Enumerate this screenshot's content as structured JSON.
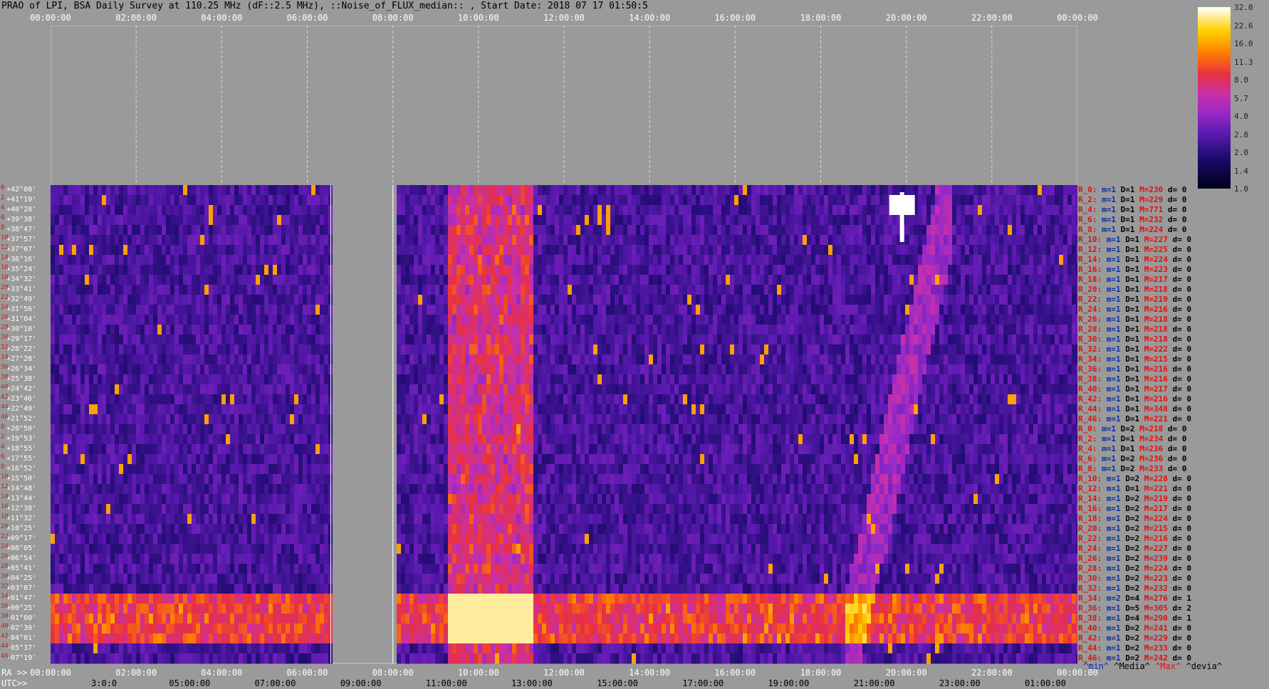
{
  "title": "PRAO of LPI, BSA Daily Survey at 110.25 MHz (dF::2.5 MHz), ::Noise_of_FLUX_median:: , Start Date: 2018 07 17 01:50:5",
  "top_ticks": [
    "00:00:00",
    "02:00:00",
    "04:00:00",
    "06:00:00",
    "08:00:00",
    "10:00:00",
    "12:00:00",
    "14:00:00",
    "16:00:00",
    "18:00:00",
    "20:00:00",
    "22:00:00",
    "00:00:00"
  ],
  "ra_label": "RA >>",
  "ra_ticks": [
    "00:00:00",
    "02:00:00",
    "04:00:00",
    "06:00:00",
    "08:00:00",
    "10:00:00",
    "12:00:00",
    "14:00:00",
    "16:00:00",
    "18:00:00",
    "20:00:00",
    "22:00:00",
    "00:00:00"
  ],
  "utc_label": "UTC>>",
  "utc_ticks": [
    "3:0:0",
    "05:00:00",
    "07:00:00",
    "09:00:00",
    "11:00:00",
    "13:00:00",
    "15:00:00",
    "17:00:00",
    "19:00:00",
    "21:00:00",
    "23:00:00",
    "01:00:00"
  ],
  "declinations": [
    "+42°08'",
    "+41°19'",
    "+40°28'",
    "+39°38'",
    "+38°47'",
    "+37°57'",
    "+37°07'",
    "+36°16'",
    "+35°24'",
    "+34°32'",
    "+33°41'",
    "+32°49'",
    "+31°56'",
    "+31°04'",
    "+30°10'",
    "+29°17'",
    "+28°22'",
    "+27°28'",
    "+26°34'",
    "+25°38'",
    "+24°42'",
    "+23°46'",
    "+22°49'",
    "+21°52'",
    "+20°50'",
    "+19°53'",
    "+18°55'",
    "+17°55'",
    "+16°52'",
    "+15°50'",
    "+14°48'",
    "+13°44'",
    "+12°38'",
    "+11°32'",
    "+10°25'",
    "+09°17'",
    "+08°05'",
    "+06°54'",
    "+05°41'",
    "+04°25'",
    "+03°07'",
    "+01°47'",
    "+00°25'",
    "-01°00'",
    "-02°30'",
    "-04°01'",
    "-05°37'",
    "-07°19'"
  ],
  "row_indices": [
    "0",
    "2",
    "4",
    "6",
    "8",
    "10",
    "12",
    "14",
    "16",
    "18",
    "20",
    "22",
    "24",
    "26",
    "28",
    "30",
    "32",
    "34",
    "36",
    "38",
    "40",
    "42",
    "44",
    "46",
    "0",
    "2",
    "4",
    "6",
    "8",
    "10",
    "12",
    "14",
    "16",
    "18",
    "20",
    "22",
    "24",
    "26",
    "28",
    "30",
    "32",
    "34",
    "36",
    "38",
    "40",
    "42",
    "44",
    "46"
  ],
  "stats": [
    {
      "r": "R_0:",
      "m": "m=1",
      "D": "D=1",
      "M": "M=230",
      "d": "d= 0"
    },
    {
      "r": "R_2:",
      "m": "m=1",
      "D": "D=1",
      "M": "M=229",
      "d": "d= 0"
    },
    {
      "r": "R_4:",
      "m": "m=1",
      "D": "D=1",
      "M": "M=771",
      "d": "d= 0"
    },
    {
      "r": "R_6:",
      "m": "m=1",
      "D": "D=1",
      "M": "M=232",
      "d": "d= 0"
    },
    {
      "r": "R_8:",
      "m": "m=1",
      "D": "D=1",
      "M": "M=224",
      "d": "d= 0"
    },
    {
      "r": "R_10:",
      "m": "m=1",
      "D": "D=1",
      "M": "M=227",
      "d": "d= 0"
    },
    {
      "r": "R_12:",
      "m": "m=1",
      "D": "D=1",
      "M": "M=225",
      "d": "d= 0"
    },
    {
      "r": "R_14:",
      "m": "m=1",
      "D": "D=1",
      "M": "M=224",
      "d": "d= 0"
    },
    {
      "r": "R_16:",
      "m": "m=1",
      "D": "D=1",
      "M": "M=223",
      "d": "d= 0"
    },
    {
      "r": "R_18:",
      "m": "m=1",
      "D": "D=1",
      "M": "M=217",
      "d": "d= 0"
    },
    {
      "r": "R_20:",
      "m": "m=1",
      "D": "D=1",
      "M": "M=218",
      "d": "d= 0"
    },
    {
      "r": "R_22:",
      "m": "m=1",
      "D": "D=1",
      "M": "M=219",
      "d": "d= 0"
    },
    {
      "r": "R_24:",
      "m": "m=1",
      "D": "D=1",
      "M": "M=216",
      "d": "d= 0"
    },
    {
      "r": "R_26:",
      "m": "m=1",
      "D": "D=1",
      "M": "M=218",
      "d": "d= 0"
    },
    {
      "r": "R_28:",
      "m": "m=1",
      "D": "D=1",
      "M": "M=218",
      "d": "d= 0"
    },
    {
      "r": "R_30:",
      "m": "m=1",
      "D": "D=1",
      "M": "M=218",
      "d": "d= 0"
    },
    {
      "r": "R_32:",
      "m": "m=1",
      "D": "D=1",
      "M": "M=222",
      "d": "d= 0"
    },
    {
      "r": "R_34:",
      "m": "m=1",
      "D": "D=1",
      "M": "M=215",
      "d": "d= 0"
    },
    {
      "r": "R_36:",
      "m": "m=1",
      "D": "D=1",
      "M": "M=216",
      "d": "d= 0"
    },
    {
      "r": "R_38:",
      "m": "m=1",
      "D": "D=1",
      "M": "M=216",
      "d": "d= 0"
    },
    {
      "r": "R_40:",
      "m": "m=1",
      "D": "D=1",
      "M": "M=217",
      "d": "d= 0"
    },
    {
      "r": "R_42:",
      "m": "m=1",
      "D": "D=1",
      "M": "M=216",
      "d": "d= 0"
    },
    {
      "r": "R_44:",
      "m": "m=1",
      "D": "D=1",
      "M": "M=348",
      "d": "d= 0"
    },
    {
      "r": "R_46:",
      "m": "m=1",
      "D": "D=1",
      "M": "M=221",
      "d": "d= 0"
    },
    {
      "r": "R_0:",
      "m": "m=1",
      "D": "D=2",
      "M": "M=218",
      "d": "d= 0"
    },
    {
      "r": "R_2:",
      "m": "m=1",
      "D": "D=1",
      "M": "M=234",
      "d": "d= 0"
    },
    {
      "r": "R_4:",
      "m": "m=1",
      "D": "D=1",
      "M": "M=236",
      "d": "d= 0"
    },
    {
      "r": "R_6:",
      "m": "m=1",
      "D": "D=2",
      "M": "M=236",
      "d": "d= 0"
    },
    {
      "r": "R_8:",
      "m": "m=1",
      "D": "D=2",
      "M": "M=233",
      "d": "d= 0"
    },
    {
      "r": "R_10:",
      "m": "m=1",
      "D": "D=2",
      "M": "M=228",
      "d": "d= 0"
    },
    {
      "r": "R_12:",
      "m": "m=1",
      "D": "D=1",
      "M": "M=221",
      "d": "d= 0"
    },
    {
      "r": "R_14:",
      "m": "m=1",
      "D": "D=2",
      "M": "M=219",
      "d": "d= 0"
    },
    {
      "r": "R_16:",
      "m": "m=1",
      "D": "D=2",
      "M": "M=217",
      "d": "d= 0"
    },
    {
      "r": "R_18:",
      "m": "m=1",
      "D": "D=2",
      "M": "M=224",
      "d": "d= 0"
    },
    {
      "r": "R_20:",
      "m": "m=1",
      "D": "D=2",
      "M": "M=215",
      "d": "d= 0"
    },
    {
      "r": "R_22:",
      "m": "m=1",
      "D": "D=2",
      "M": "M=216",
      "d": "d= 0"
    },
    {
      "r": "R_24:",
      "m": "m=1",
      "D": "D=2",
      "M": "M=227",
      "d": "d= 0"
    },
    {
      "r": "R_26:",
      "m": "m=1",
      "D": "D=2",
      "M": "M=239",
      "d": "d= 0"
    },
    {
      "r": "R_28:",
      "m": "m=1",
      "D": "D=2",
      "M": "M=224",
      "d": "d= 0"
    },
    {
      "r": "R_30:",
      "m": "m=1",
      "D": "D=2",
      "M": "M=223",
      "d": "d= 0"
    },
    {
      "r": "R_32:",
      "m": "m=1",
      "D": "D=2",
      "M": "M=232",
      "d": "d= 0"
    },
    {
      "r": "R_34:",
      "m": "m=2",
      "D": "D=4",
      "M": "M=276",
      "d": "d= 1"
    },
    {
      "r": "R_36:",
      "m": "m=1",
      "D": "D=5",
      "M": "M=305",
      "d": "d= 2"
    },
    {
      "r": "R_38:",
      "m": "m=1",
      "D": "D=4",
      "M": "M=290",
      "d": "d= 1"
    },
    {
      "r": "R_40:",
      "m": "m=1",
      "D": "D=2",
      "M": "M=241",
      "d": "d= 0"
    },
    {
      "r": "R_42:",
      "m": "m=1",
      "D": "D=2",
      "M": "M=229",
      "d": "d= 0"
    },
    {
      "r": "R_44:",
      "m": "m=1",
      "D": "D=2",
      "M": "M=233",
      "d": "d= 0"
    },
    {
      "r": "R_46:",
      "m": "m=1",
      "D": "D=2",
      "M": "M=242",
      "d": "d= 0"
    }
  ],
  "legend_keys": {
    "min": "^min^",
    "media": "^Media^",
    "max": "^Max^",
    "devia": "^devia^"
  },
  "colors": {
    "min": "#0a2ea8",
    "media": "#000000",
    "max": "#e01010",
    "devia": "#000000"
  },
  "colorbar": {
    "ticks": [
      "32.0",
      "22.6",
      "16.0",
      "11.3",
      "8.0",
      "5.7",
      "4.0",
      "2.8",
      "2.0",
      "1.4",
      "1.0"
    ]
  },
  "chart_data": {
    "type": "heatmap",
    "title": "PRAO of LPI, BSA Daily Survey at 110.25 MHz (dF::2.5 MHz), ::Noise_of_FLUX_median:: , Start Date: 2018 07 17 01:50:5",
    "x_axis": "RA",
    "x_ticks": [
      "00:00:00",
      "02:00:00",
      "04:00:00",
      "06:00:00",
      "08:00:00",
      "10:00:00",
      "12:00:00",
      "14:00:00",
      "16:00:00",
      "18:00:00",
      "20:00:00",
      "22:00:00",
      "00:00:00"
    ],
    "x_range_hours": [
      0,
      24
    ],
    "data_gap_ra_hours": [
      6.55,
      8.0
    ],
    "rows": 48,
    "colorbar_range": [
      1.0,
      32.0
    ],
    "colorbar_scale": "log",
    "features": [
      {
        "name": "vertical bright band",
        "ra_hours": [
          9.2,
          11.2
        ],
        "level": "high"
      },
      {
        "name": "horizontal bright band",
        "rows": [
          41,
          45
        ],
        "level": "high"
      },
      {
        "name": "source",
        "ra_hours": 19.9,
        "rows": [
          1,
          3
        ],
        "level": "saturated"
      },
      {
        "name": "diagonal drift",
        "ra_hours": [
          18.5,
          21
        ],
        "level": "medium"
      }
    ]
  }
}
